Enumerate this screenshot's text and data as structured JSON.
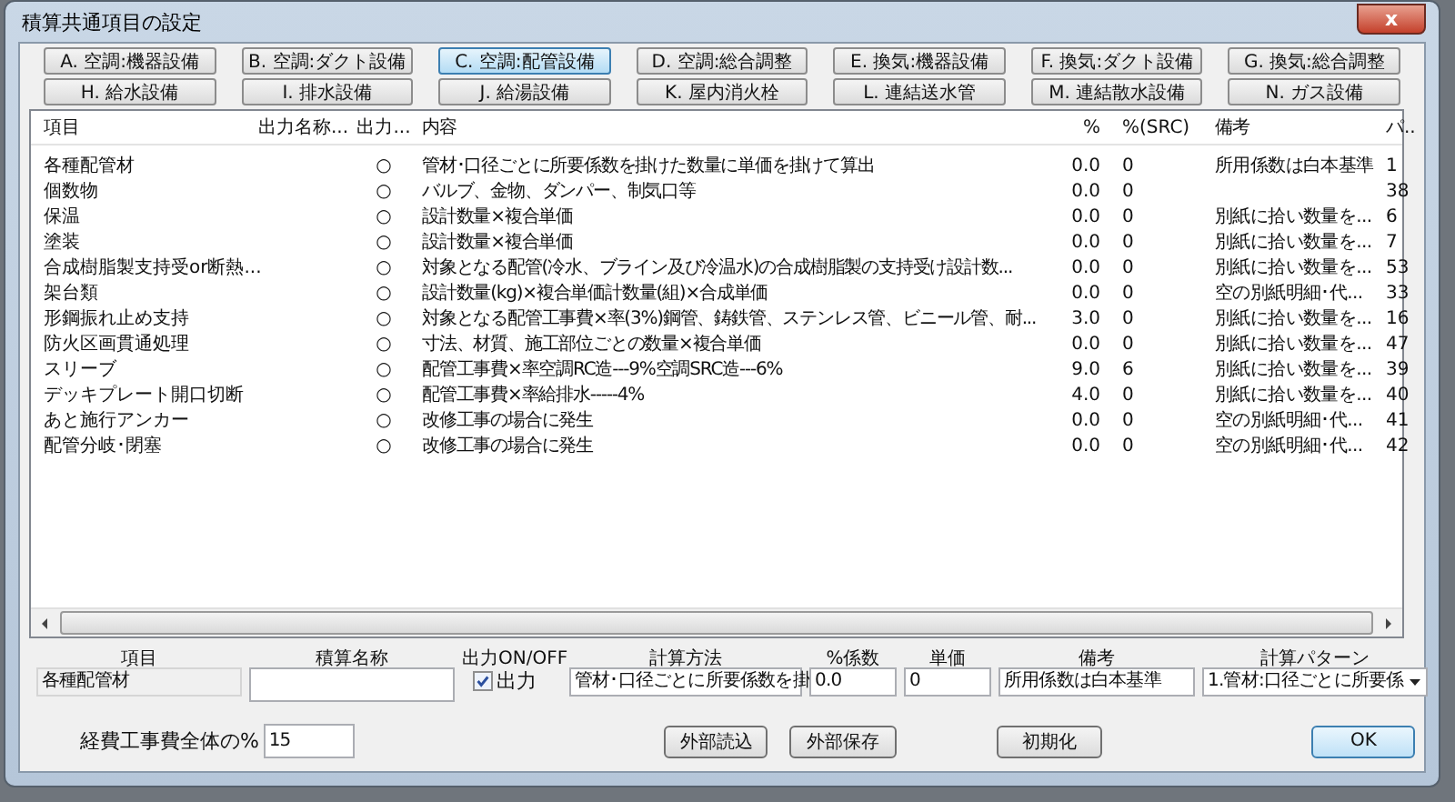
{
  "window": {
    "title": "積算共通項目の設定",
    "close": "x"
  },
  "category_buttons": [
    {
      "label": "A. 空調:機器設備",
      "selected": false
    },
    {
      "label": "B. 空調:ダクト設備",
      "selected": false
    },
    {
      "label": "C. 空調:配管設備",
      "selected": true
    },
    {
      "label": "D. 空調:総合調整",
      "selected": false
    },
    {
      "label": "E. 換気:機器設備",
      "selected": false
    },
    {
      "label": "F. 換気:ダクト設備",
      "selected": false
    },
    {
      "label": "G. 換気:総合調整",
      "selected": false
    },
    {
      "label": "H. 給水設備",
      "selected": false
    },
    {
      "label": "I. 排水設備",
      "selected": false
    },
    {
      "label": "J. 給湯設備",
      "selected": false
    },
    {
      "label": "K. 屋内消火栓",
      "selected": false
    },
    {
      "label": "L. 連結送水管",
      "selected": false
    },
    {
      "label": "M. 連結散水設備",
      "selected": false
    },
    {
      "label": "N. ガス設備",
      "selected": false
    }
  ],
  "table": {
    "columns": [
      "項目",
      "出力名称...",
      "出力...",
      "内容",
      "%",
      "%(SRC)",
      "備考",
      "パ.."
    ],
    "rows": [
      {
        "item": "各種配管材",
        "output": "○",
        "content": "管材･口径ごとに所要係数を掛けた数量に単価を掛けて算出",
        "pct": "0.0",
        "pct_src": "0",
        "note": "所用係数は白本基準",
        "pattern": "1",
        "selected": false
      },
      {
        "item": "個数物",
        "output": "○",
        "content": "バルブ、金物、ダンパー、制気口等",
        "pct": "0.0",
        "pct_src": "0",
        "note": "",
        "pattern": "38",
        "selected": false
      },
      {
        "item": "保温",
        "output": "○",
        "content": "設計数量×複合単価",
        "pct": "0.0",
        "pct_src": "0",
        "note": "別紙に拾い数量を...",
        "pattern": "6",
        "selected": false
      },
      {
        "item": "塗装",
        "output": "○",
        "content": "設計数量×複合単価",
        "pct": "0.0",
        "pct_src": "0",
        "note": "別紙に拾い数量を...",
        "pattern": "7",
        "selected": false
      },
      {
        "item": "合成樹脂製支持受or断熱...",
        "output": "○",
        "content": "対象となる配管(冷水、ブライン及び冷温水)の合成樹脂製の支持受け設計数...",
        "pct": "0.0",
        "pct_src": "0",
        "note": "別紙に拾い数量を...",
        "pattern": "53",
        "selected": false
      },
      {
        "item": "架台類",
        "output": "○",
        "content": "設計数量(kg)×複合単価計数量(組)×合成単価",
        "pct": "0.0",
        "pct_src": "0",
        "note": "空の別紙明細･代...",
        "pattern": "33",
        "selected": false
      },
      {
        "item": "形鋼振れ止め支持",
        "output": "○",
        "content": "対象となる配管工事費×率(3%)鋼管、鋳鉄管、ステンレス管、ビニール管、耐...",
        "pct": "3.0",
        "pct_src": "0",
        "note": "別紙に拾い数量を...",
        "pattern": "16",
        "selected": false
      },
      {
        "item": "防火区画貫通処理",
        "output": "○",
        "content": "寸法、材質、施工部位ごとの数量×複合単価",
        "pct": "0.0",
        "pct_src": "0",
        "note": "別紙に拾い数量を...",
        "pattern": "47",
        "selected": false
      },
      {
        "item": "スリーブ",
        "output": "○",
        "content": "配管工事費×率空調RC造---9%空調SRC造---6%",
        "pct": "9.0",
        "pct_src": "6",
        "note": "別紙に拾い数量を...",
        "pattern": "39",
        "selected": false
      },
      {
        "item": "デッキプレート開口切断",
        "output": "○",
        "content": "配管工事費×率給排水-----4%",
        "pct": "4.0",
        "pct_src": "0",
        "note": "別紙に拾い数量を...",
        "pattern": "40",
        "selected": false
      },
      {
        "item": "あと施行アンカー",
        "output": "○",
        "content": "改修工事の場合に発生",
        "pct": "0.0",
        "pct_src": "0",
        "note": "空の別紙明細･代...",
        "pattern": "41",
        "selected": false
      },
      {
        "item": "配管分岐･閉塞",
        "output": "○",
        "content": "改修工事の場合に発生",
        "pct": "0.0",
        "pct_src": "0",
        "note": "空の別紙明細･代...",
        "pattern": "42",
        "selected": false
      }
    ]
  },
  "editor": {
    "item": {
      "label": "項目",
      "value": "各種配管材"
    },
    "name": {
      "label": "積算名称"
    },
    "output": {
      "label": "出力ON/OFF",
      "text": "出力",
      "checked": true
    },
    "method": {
      "label": "計算方法",
      "value": "管材･口径ごとに所要係数を掛"
    },
    "factor": {
      "label": "%係数",
      "value": "0.0"
    },
    "price": {
      "label": "単価",
      "value": "0"
    },
    "note": {
      "label": "備考",
      "value": "所用係数は白本基準"
    },
    "pattern": {
      "label": "計算パターン",
      "value": "1.管材:口径ごとに所要係"
    }
  },
  "overhead": {
    "label": "経費工事費全体の%",
    "value": "15"
  },
  "buttons": [
    "外部読込",
    "外部保存",
    "初期化",
    "OK"
  ]
}
